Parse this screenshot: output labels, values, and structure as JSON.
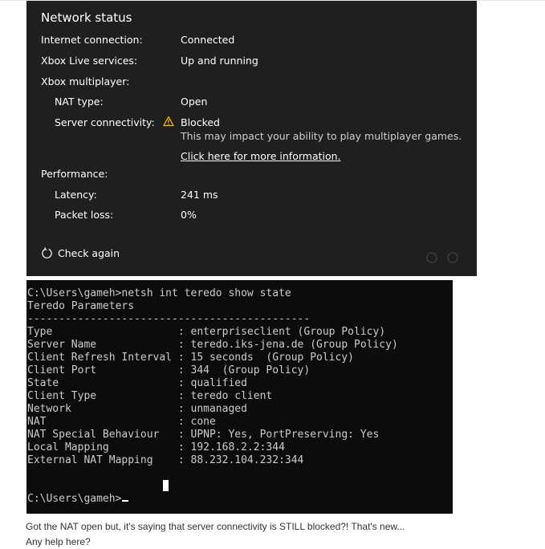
{
  "network_status": {
    "title": "Network status",
    "rows": {
      "internet_connection": {
        "label": "Internet connection:",
        "value": "Connected"
      },
      "xbox_live": {
        "label": "Xbox Live services:",
        "value": "Up and running"
      },
      "xbox_multiplayer": {
        "label": "Xbox multiplayer:"
      },
      "nat_type": {
        "label": "NAT type:",
        "value": "Open"
      },
      "server_connectivity": {
        "label": "Server connectivity:",
        "value": "Blocked",
        "icon": "warning-icon",
        "status_color": "#ffb900",
        "note": "This may impact your ability to play multiplayer games.",
        "link": "Click here for more information."
      },
      "performance": {
        "label": "Performance:"
      },
      "latency": {
        "label": "Latency:",
        "value": "241 ms"
      },
      "packet_loss": {
        "label": "Packet loss:",
        "value": "0%"
      }
    },
    "check_again": {
      "label": "Check again",
      "icon": "refresh-icon"
    },
    "background_color": "#1f1f1f"
  },
  "terminal": {
    "command_line": "C:\\Users\\gameh>netsh int teredo show state",
    "heading": "Teredo Parameters",
    "separator": "---------------------------------------------",
    "rows": [
      {
        "key": "Type                   ",
        "value": ": enterpriseclient (Group Policy)"
      },
      {
        "key": "Server Name            ",
        "value": ": teredo.iks-jena.de (Group Policy)"
      },
      {
        "key": "Client Refresh Interval",
        "value": ": 15 seconds  (Group Policy)"
      },
      {
        "key": "Client Port            ",
        "value": ": 344  (Group Policy)"
      },
      {
        "key": "State                  ",
        "value": ": qualified"
      },
      {
        "key": "Client Type            ",
        "value": ": teredo client"
      },
      {
        "key": "Network                ",
        "value": ": unmanaged"
      },
      {
        "key": "NAT                    ",
        "value": ": cone"
      },
      {
        "key": "NAT Special Behaviour  ",
        "value": ": UPNP: Yes, PortPreserving: Yes"
      },
      {
        "key": "Local Mapping          ",
        "value": ": 192.168.2.2:344"
      },
      {
        "key": "External NAT Mapping   ",
        "value": ": 88.232.104.232:344"
      }
    ],
    "prompt": "C:\\Users\\gameh>",
    "background_color": "#0c0c0c"
  },
  "post": {
    "line1": "Got the NAT open but, it's saying that server connectivity is STILL blocked?! That's new...",
    "line2": "Any help here?"
  }
}
